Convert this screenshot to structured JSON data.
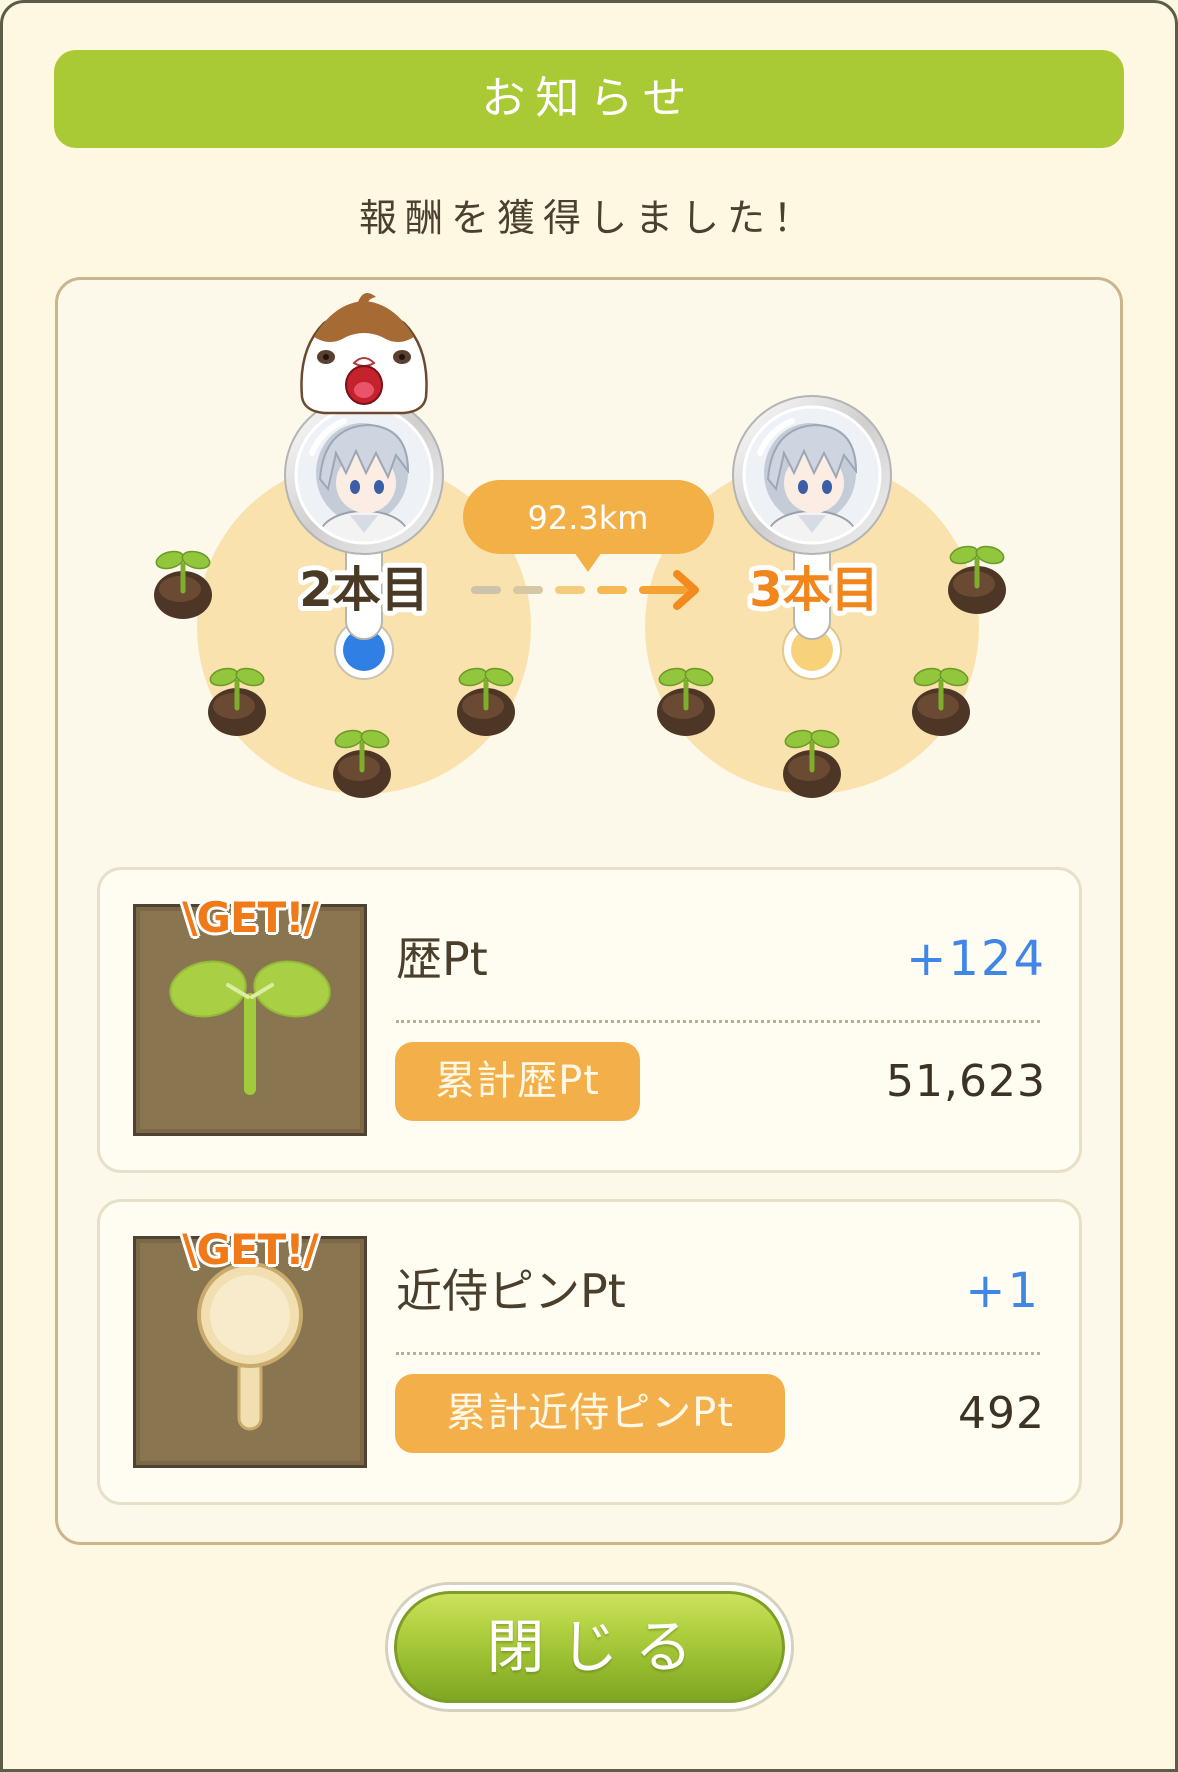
{
  "header": {
    "title": "お知らせ"
  },
  "message": "報酬を獲得しました！",
  "map": {
    "from_label": "2本目",
    "to_label": "3本目",
    "distance": "92.3km",
    "icons": [
      "bird-mascot-icon",
      "character-pin-icon",
      "sprout-icon",
      "dashed-arrow-icon"
    ]
  },
  "rewards": [
    {
      "badge": "\\GET!/",
      "icon": "sprout-icon",
      "name": "歴Pt",
      "gain": "+124",
      "total_label": "累計歴Pt",
      "total": "51,623"
    },
    {
      "badge": "\\GET!/",
      "icon": "pin-icon",
      "name": "近侍ピンPt",
      "gain": "+1",
      "total_label": "累計近侍ピンPt",
      "total": "492"
    }
  ],
  "close_button": {
    "label": "閉じる"
  },
  "colors": {
    "header_green": "#a9c935",
    "gain_blue": "#3f86e6",
    "pill_orange": "#f3b04a",
    "destination_orange": "#f0861c",
    "origin_blue": "#2f7fe4",
    "text_brown": "#4a3e2c",
    "background_cream": "#fef7e1"
  }
}
